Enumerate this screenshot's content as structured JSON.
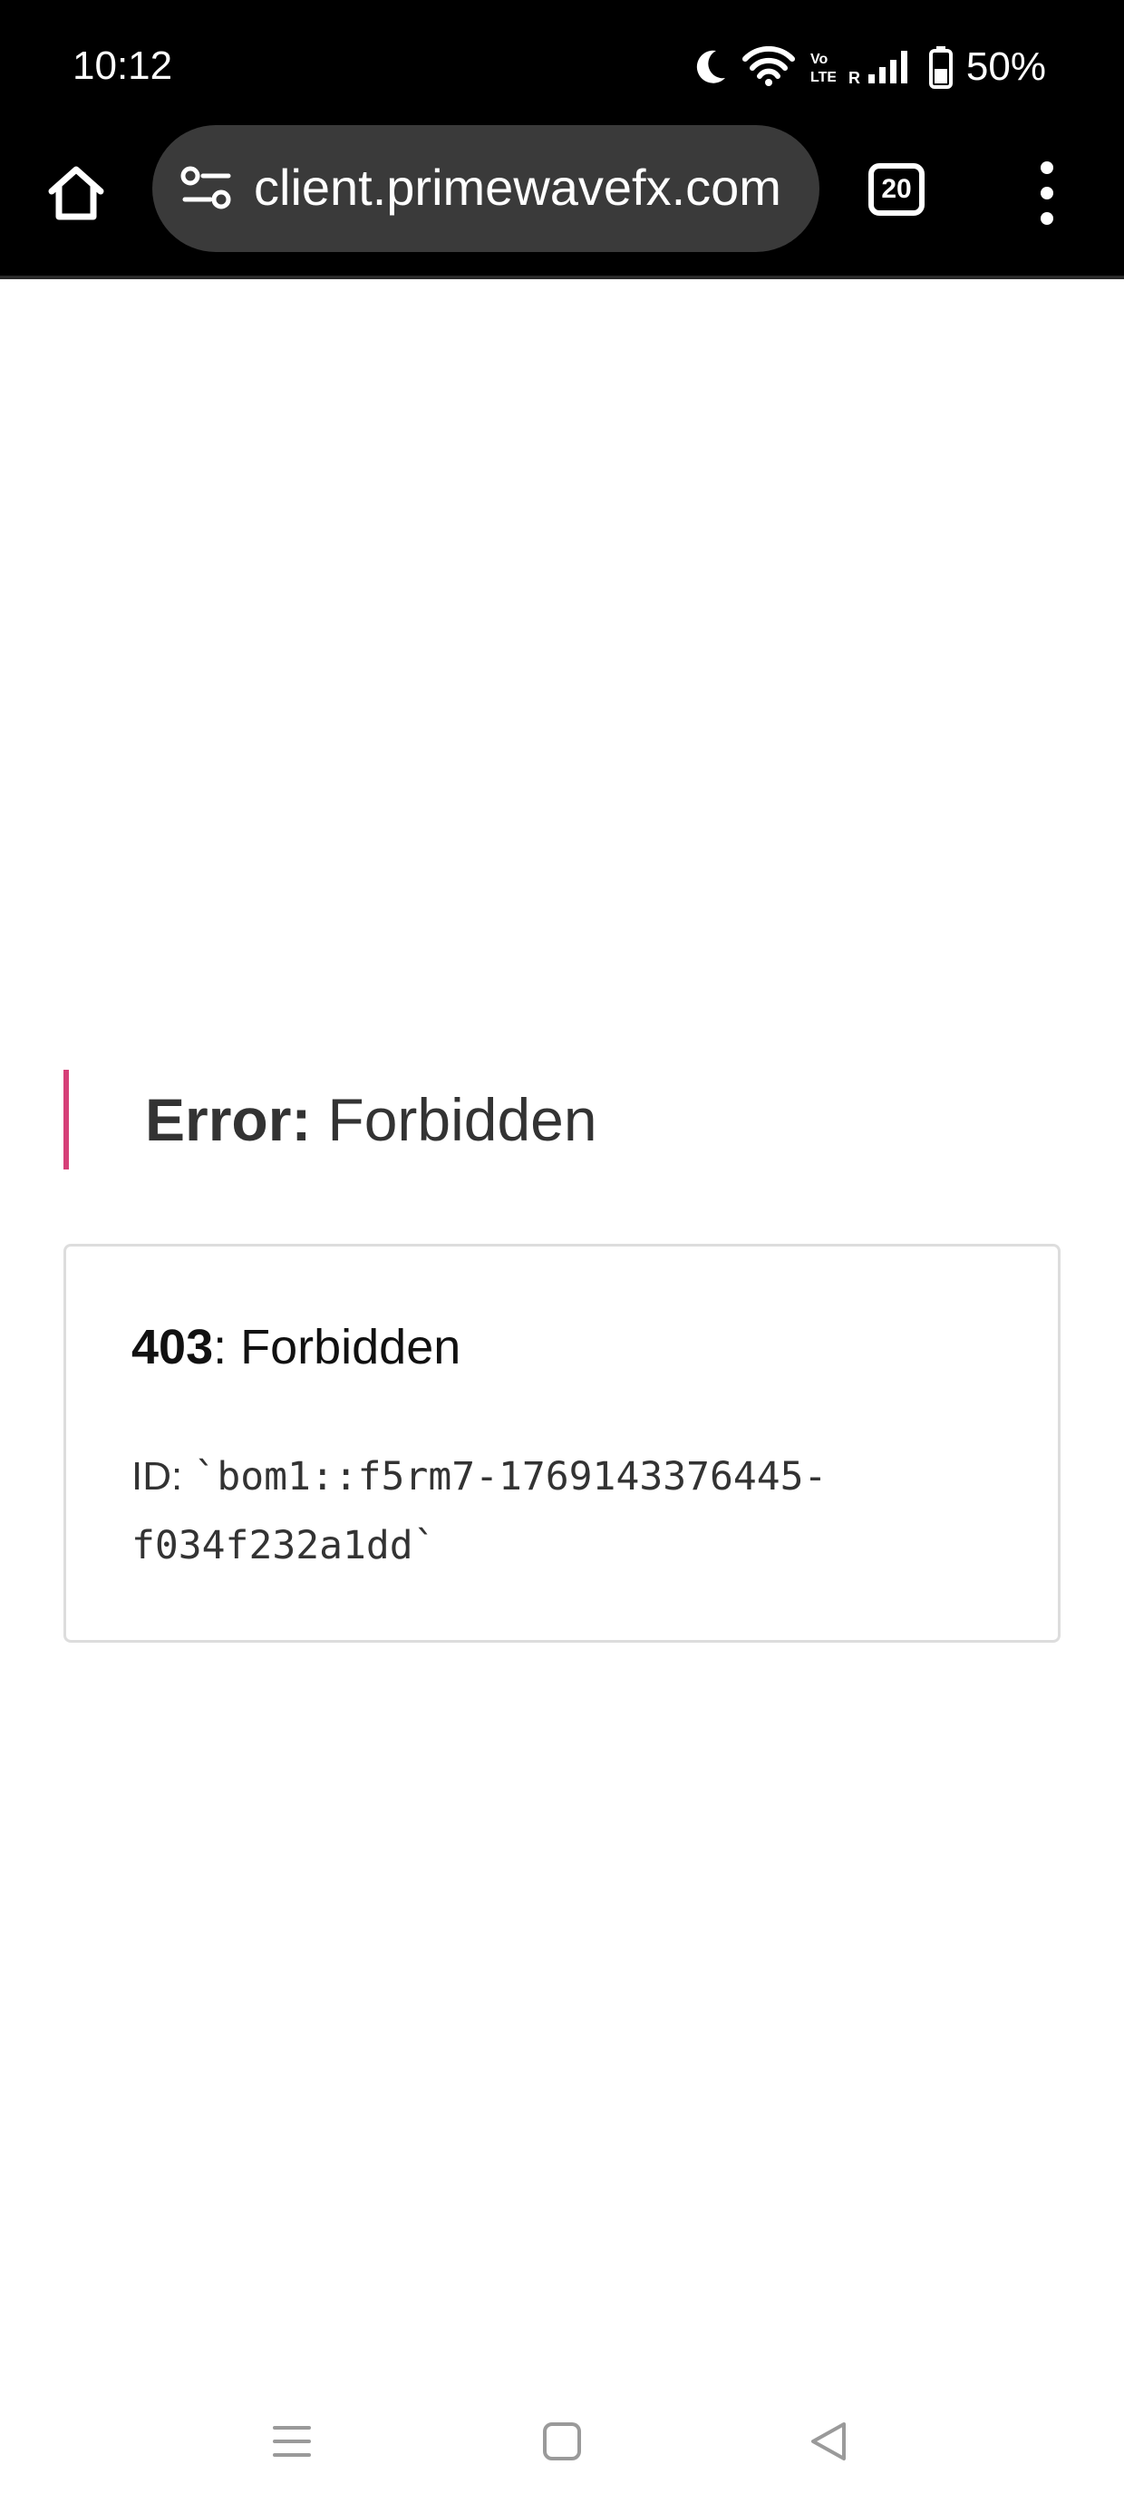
{
  "status_bar": {
    "time": "10:12",
    "battery_percent": "50%",
    "icons": [
      "moon-icon",
      "wifi-icon",
      "volte-icon",
      "signal-icon",
      "battery-icon"
    ]
  },
  "browser": {
    "url": "client.primewavefx.com",
    "tab_count": "20",
    "icons": [
      "home-icon",
      "site-settings-icon",
      "overflow-menu-icon"
    ]
  },
  "page": {
    "heading_label": "Error:",
    "heading_text": "Forbidden",
    "error_code": "403",
    "error_message": ": Forbidden",
    "id_label": "ID: ",
    "id_value": "`bom1::f5rm7-1769143376445-f034f232a1dd`",
    "accent_color": "#d63f78"
  },
  "nav_bar": {
    "icons": [
      "recents-icon",
      "home-square-icon",
      "back-icon"
    ]
  }
}
